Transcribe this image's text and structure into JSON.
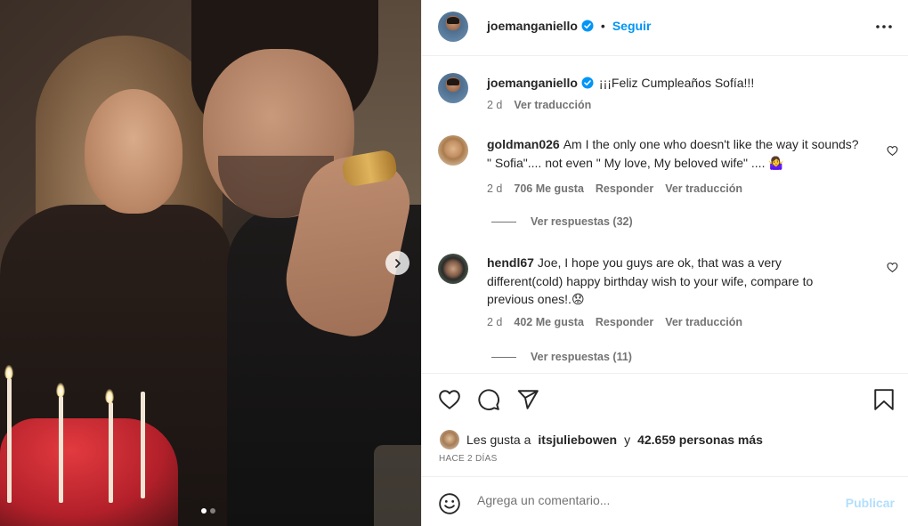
{
  "post": {
    "username": "joemanganiello",
    "follow_label": "Seguir",
    "separator": "•"
  },
  "caption": {
    "username": "joemanganiello",
    "text": "¡¡¡Feliz Cumpleaños Sofía!!!",
    "age": "2 d",
    "translate": "Ver traducción"
  },
  "comments": [
    {
      "username": "goldman026",
      "text": "Am I the only one who doesn't like the way it sounds? \" Sofia\".... not even \" My love, My beloved wife\" .... 🤷‍♀️",
      "age": "2 d",
      "likes": "706 Me gusta",
      "reply": "Responder",
      "translate": "Ver traducción",
      "view_replies": "Ver respuestas (32)"
    },
    {
      "username": "hendl67",
      "text": "Joe, I hope you guys are ok, that was a very different(cold) happy birthday wish to your wife, compare to previous ones!.😟",
      "age": "2 d",
      "likes": "402 Me gusta",
      "reply": "Responder",
      "translate": "Ver traducción",
      "view_replies": "Ver respuestas (11)"
    }
  ],
  "likes": {
    "prefix": "Les gusta a",
    "user": "itsjuliebowen",
    "middle": "y",
    "count": "42.659 personas más"
  },
  "timestamp": "HACE 2 DÍAS",
  "composer": {
    "placeholder": "Agrega un comentario...",
    "post_label": "Publicar"
  },
  "carousel": {
    "slides": 2,
    "current": 1
  },
  "colors": {
    "accent": "#0095f6",
    "verified": "#0095f6",
    "muted": "#737373",
    "post_disabled": "#b2dffc"
  }
}
